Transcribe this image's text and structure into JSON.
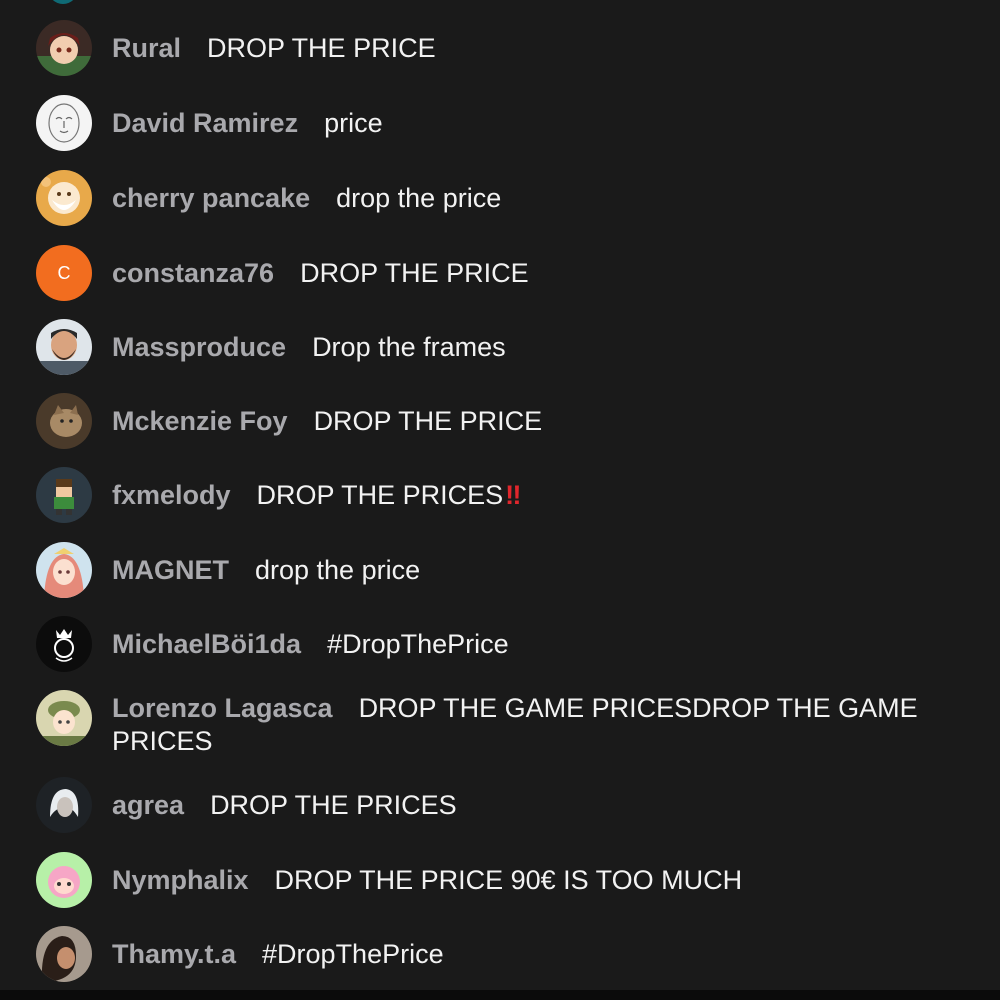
{
  "messages": [
    {
      "user": "Rural",
      "text": "DROP THE PRICE",
      "avatar": "anime-boy-avatar"
    },
    {
      "user": "David Ramirez",
      "text": "price",
      "avatar": "sketch-face-avatar"
    },
    {
      "user": "cherry pancake",
      "text": "drop the price",
      "avatar": "old-man-avatar"
    },
    {
      "user": "constanza76",
      "text": "DROP THE PRICE",
      "avatar": "letter-avatar",
      "initial": "C",
      "color": "#f26d1f"
    },
    {
      "user": "Massproduce",
      "text": "Drop the frames",
      "avatar": "bearded-man-avatar"
    },
    {
      "user": "Mckenzie Foy",
      "text": "DROP THE PRICE",
      "avatar": "cat-photo-avatar"
    },
    {
      "user": "fxmelody",
      "text": "DROP THE PRICES",
      "emoji": "‼",
      "avatar": "pixel-character-avatar"
    },
    {
      "user": "MAGNET",
      "text": "drop the price",
      "avatar": "anime-girl-avatar"
    },
    {
      "user": "MichaelBöi1da",
      "text": "#DropThePrice",
      "avatar": "crest-logo-avatar"
    },
    {
      "user": "Lorenzo Lagasca",
      "text": "DROP THE GAME PRICESDROP THE GAME PRICES",
      "avatar": "anime-soldier-avatar"
    },
    {
      "user": "agrea",
      "text": "DROP THE PRICES",
      "avatar": "white-hair-avatar"
    },
    {
      "user": "Nymphalix",
      "text": "DROP THE PRICE 90€ IS TOO MUCH",
      "avatar": "pink-character-avatar"
    },
    {
      "user": "Thamy.t.a",
      "text": "#DropThePrice",
      "avatar": "photo-woman-avatar"
    }
  ],
  "colors": {
    "background": "#1a1a1a",
    "username": "#a9a9ad",
    "message": "#f2f2f2",
    "emoji": "#e0262c"
  }
}
